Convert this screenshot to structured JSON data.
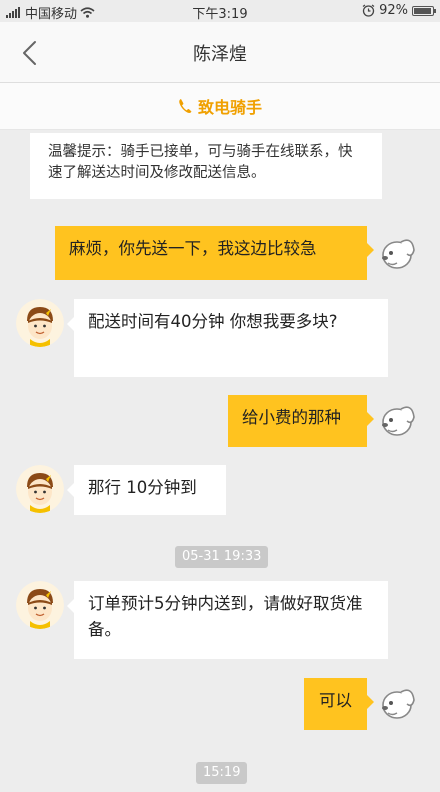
{
  "status_bar": {
    "carrier": "中国移动",
    "time": "下午3:19",
    "battery_percent_label": "92%",
    "battery_level": 0.92,
    "icons": [
      "signal-icon",
      "wifi-icon",
      "alarm-icon",
      "battery-icon"
    ]
  },
  "nav": {
    "back_icon": "chevron-left-icon",
    "title": "陈泽煌"
  },
  "call_bar": {
    "icon": "phone-icon",
    "label": "致电骑手"
  },
  "tip": {
    "text": "温馨提示：骑手已接单，可与骑手在线联系，快速了解送达时间及修改配送信息。"
  },
  "messages": {
    "m1": {
      "from": "me",
      "text": "麻烦，你先送一下，我这边比较急"
    },
    "m2": {
      "from": "rider",
      "text": "配送时间有40分钟  你想我要多块?"
    },
    "m3": {
      "from": "me",
      "text": "给小费的那种"
    },
    "m4": {
      "from": "rider",
      "text": "那行  10分钟到"
    },
    "m5": {
      "from": "rider",
      "text": "订单预计5分钟内送到，请做好取货准备。"
    },
    "m6": {
      "from": "me",
      "text": "可以"
    }
  },
  "timestamps": {
    "t1": "05-31 19:33",
    "t2": "15:19"
  },
  "colors": {
    "accent": "#f0a000",
    "my_bubble": "#ffc31f",
    "rider_bubble": "#ffffff",
    "background": "#ededed",
    "timestamp_bg": "#c9c9c9"
  }
}
